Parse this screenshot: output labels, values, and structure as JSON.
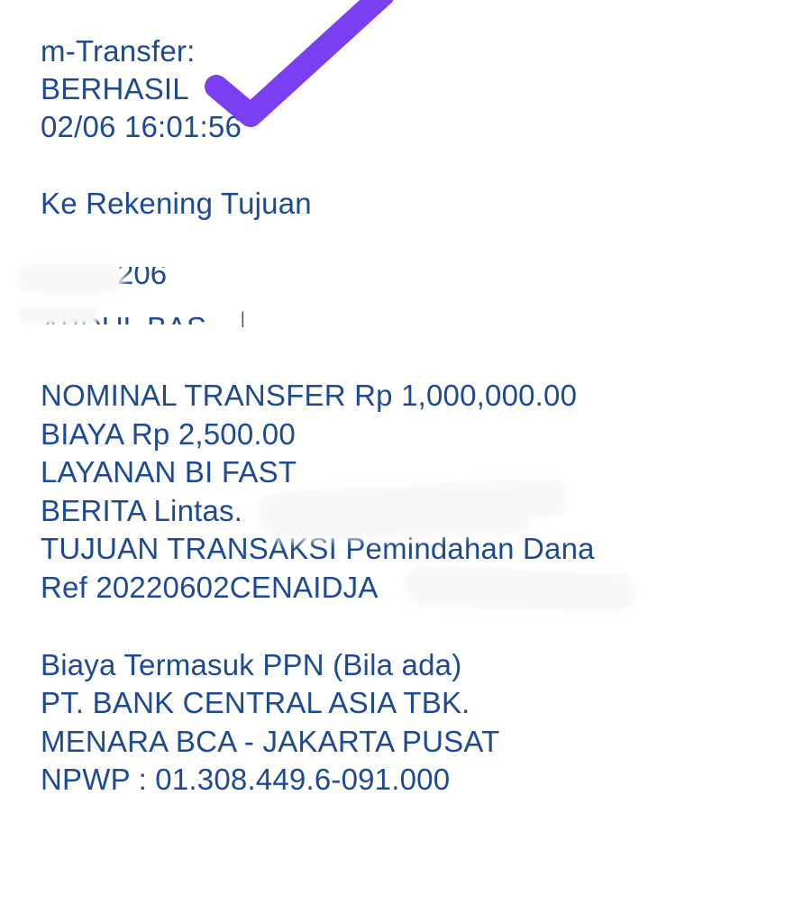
{
  "header": {
    "app": "m-Transfer:",
    "status": "BERHASIL",
    "datetime": "02/06 16:01:56"
  },
  "destination": {
    "label": "Ke Rekening Tujuan",
    "account_partial": "206",
    "name_partial": "ABDUL BAS"
  },
  "details": {
    "nominal": "NOMINAL TRANSFER Rp 1,000,000.00",
    "fee": "BIAYA Rp 2,500.00",
    "service": "LAYANAN BI FAST",
    "message": "BERITA Lintas.",
    "purpose": "TUJUAN TRANSAKSI Pemindahan Dana",
    "ref": "Ref 20220602CENAIDJA"
  },
  "footer": {
    "tax_note": "Biaya Termasuk PPN (Bila ada)",
    "bank": "PT. BANK CENTRAL ASIA TBK.",
    "address": "MENARA BCA - JAKARTA PUSAT",
    "npwp": "NPWP : 01.308.449.6-091.000"
  },
  "colors": {
    "text": "#1d4a93",
    "checkmark": "#7b3ff2",
    "redaction": "#f7f7f8"
  },
  "icons": {
    "status": "checkmark-icon"
  }
}
